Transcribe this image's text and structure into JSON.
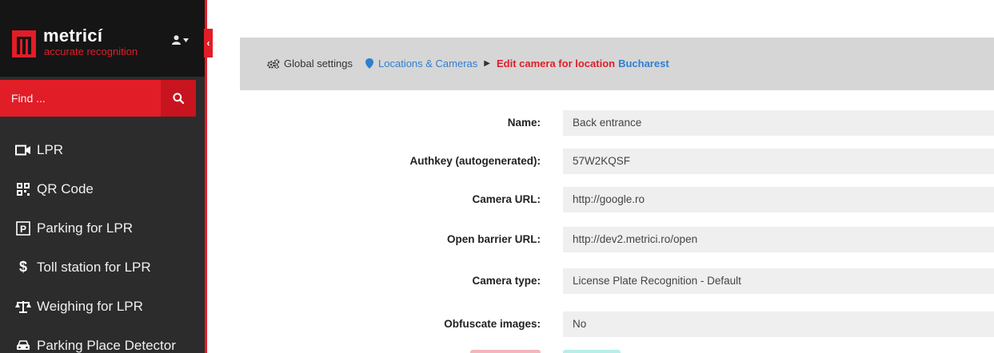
{
  "brand": {
    "name": "metricí",
    "tagline": "accurate recognition"
  },
  "search": {
    "placeholder": "Find ..."
  },
  "nav": [
    {
      "label": "LPR",
      "icon": "video-camera-icon"
    },
    {
      "label": "QR Code",
      "icon": "qr-code-icon"
    },
    {
      "label": "Parking for LPR",
      "icon": "parking-icon"
    },
    {
      "label": "Toll station for LPR",
      "icon": "dollar-icon"
    },
    {
      "label": "Weighing for LPR",
      "icon": "balance-scale-icon"
    },
    {
      "label": "Parking Place Detector",
      "icon": "car-icon"
    }
  ],
  "breadcrumb": {
    "global": "Global settings",
    "locations": "Locations & Cameras",
    "edit": "Edit camera for location",
    "city": "Bucharest"
  },
  "form": {
    "name": {
      "label": "Name:",
      "value": "Back entrance"
    },
    "authkey": {
      "label": "Authkey (autogenerated):",
      "value": "57W2KQSF"
    },
    "camera_url": {
      "label": "Camera URL:",
      "value": "http://google.ro"
    },
    "barrier_url": {
      "label": "Open barrier URL:",
      "value": "http://dev2.metrici.ro/open"
    },
    "camera_type": {
      "label": "Camera type:",
      "value": "License Plate Recognition - Default"
    },
    "obfuscate": {
      "label": "Obfuscate images:",
      "value": "No"
    }
  },
  "colors": {
    "accent": "#e11d28",
    "sidebar": "#2c2c2c",
    "link": "#2f7fcf",
    "header": "#d6d6d6"
  }
}
